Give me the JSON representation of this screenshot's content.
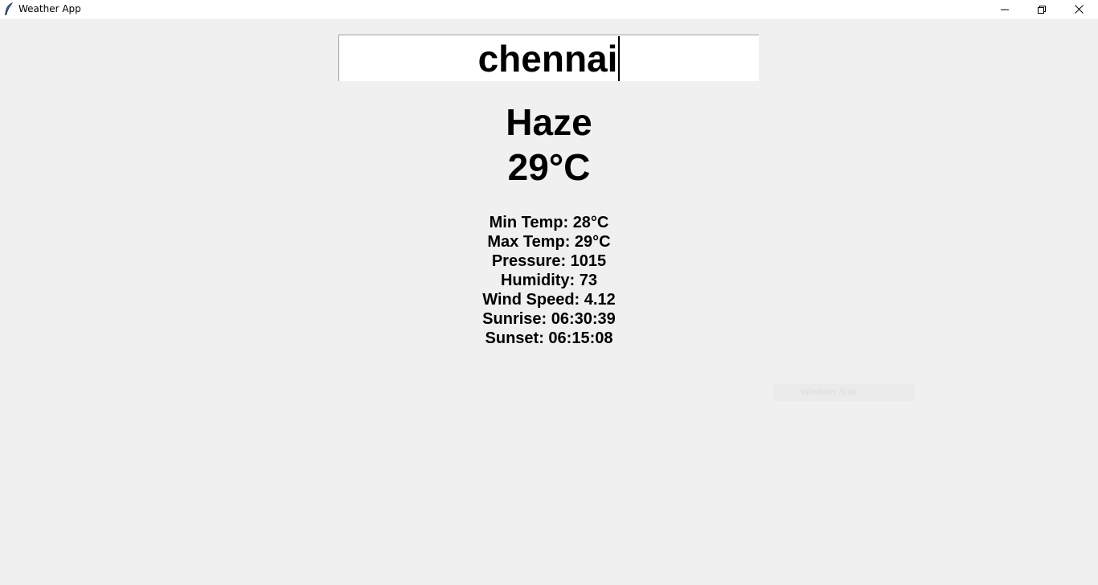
{
  "window": {
    "title": "Weather App",
    "icon": "feather-icon"
  },
  "search": {
    "value": "chennai"
  },
  "weather": {
    "condition": "Haze",
    "temperature": "29°C"
  },
  "details": [
    "Min Temp: 28°C",
    "Max Temp: 29°C",
    "Pressure: 1015",
    "Humidity: 73",
    "Wind Speed: 4.12",
    "Sunrise: 06:30:39",
    "Sunset: 06:15:08"
  ],
  "overlay": {
    "snip_label": "Windows Snip"
  }
}
